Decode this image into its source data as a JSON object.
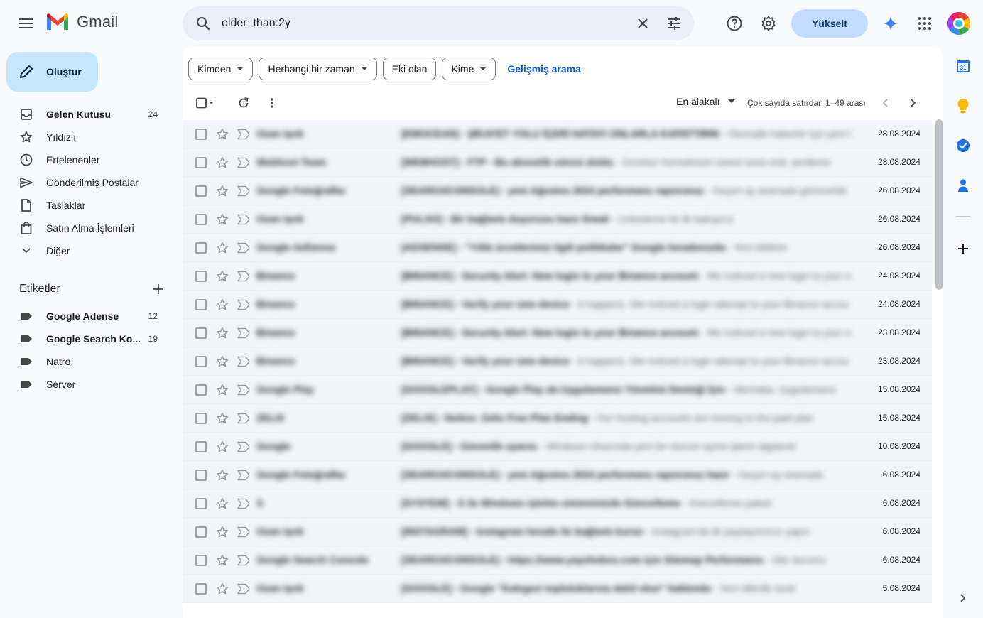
{
  "app": {
    "name": "Gmail"
  },
  "search": {
    "value": "older_than:2y"
  },
  "header": {
    "upgrade_label": "Yükselt"
  },
  "compose": {
    "label": "Oluştur"
  },
  "nav": [
    {
      "label": "Gelen Kutusu",
      "count": "24",
      "icon": "inbox-icon",
      "bold": true
    },
    {
      "label": "Yıldızlı",
      "count": "",
      "icon": "star-icon",
      "bold": false
    },
    {
      "label": "Ertelenenler",
      "count": "",
      "icon": "clock-icon",
      "bold": false
    },
    {
      "label": "Gönderilmiş Postalar",
      "count": "",
      "icon": "send-icon",
      "bold": false
    },
    {
      "label": "Taslaklar",
      "count": "",
      "icon": "draft-icon",
      "bold": false
    },
    {
      "label": "Satın Alma İşlemleri",
      "count": "",
      "icon": "shopping-bag-icon",
      "bold": false
    },
    {
      "label": "Diğer",
      "count": "",
      "icon": "chevron-down-icon",
      "bold": false
    }
  ],
  "labels": {
    "title": "Etiketler",
    "items": [
      {
        "label": "Google Adense",
        "count": "12",
        "bold": true
      },
      {
        "label": "Google Search Ko...",
        "count": "19",
        "bold": true
      },
      {
        "label": "Natro",
        "count": "",
        "bold": false
      },
      {
        "label": "Server",
        "count": "",
        "bold": false
      }
    ]
  },
  "filters": {
    "chips": [
      {
        "label": "Kimden",
        "dropdown": true
      },
      {
        "label": "Herhangi bir zaman",
        "dropdown": true
      },
      {
        "label": "Eki olan",
        "dropdown": false
      },
      {
        "label": "Kime",
        "dropdown": true
      }
    ],
    "advanced_label": "Gelişmiş arama"
  },
  "toolbar": {
    "sort_label": "En alakalı",
    "range_label": "Çok sayıda satırdan 1–49 arası"
  },
  "emails": [
    {
      "sender": "Ozan Işırk",
      "subject": "[EMOCEAN] - ŞİKAYET YOLU İÇERİ HATAYI ONLARLA KAPATTIRIN",
      "snippet": "Otomatik haberler için yeni kayıt",
      "date": "28.08.2024"
    },
    {
      "sender": "Webhost Team",
      "subject": "[WEBHOST] - FTP - Bu abonelik süresi doldu",
      "snippet": "Ücretsiz hizmetinizin süresi sona erdi, yenileme",
      "date": "28.08.2024"
    },
    {
      "sender": "Google Fotoğraflar",
      "subject": "[SEARCHCONSOLE] - yeni Ağustos 2024 performans raporunuz",
      "snippet": "Geçen ay aramada görünürlük",
      "date": "26.08.2024"
    },
    {
      "sender": "Ozan Işırk",
      "subject": "[PULSO] - Bir bağlantı duyurusu hazır Email",
      "snippet": "Linkedeme ile ilk bakışınız",
      "date": "26.08.2024"
    },
    {
      "sender": "Google AdSense",
      "subject": "[ADSENSE] - \"Yıllık ücretlerinizi ilgili politikalar\" Google hesabınızda",
      "snippet": "Yeni bildirim",
      "date": "26.08.2024"
    },
    {
      "sender": "Binance",
      "subject": "[BINANCE] - Security Alert: New login to your Binance account",
      "snippet": "We noticed a new login to your acc",
      "date": "24.08.2024"
    },
    {
      "sender": "Binance",
      "subject": "[BINANCE] - Verify your new device",
      "snippet": "It happens. We noticed a login attempt to your Binance accou",
      "date": "24.08.2024"
    },
    {
      "sender": "Binance",
      "subject": "[BINANCE] - Security Alert: New login to your Binance account",
      "snippet": "We noticed a new login to your acc",
      "date": "23.08.2024"
    },
    {
      "sender": "Binance",
      "subject": "[BINANCE] - Verify your new device",
      "snippet": "It happens. We noticed a login attempt to your Binance accou",
      "date": "23.08.2024"
    },
    {
      "sender": "Google Play",
      "subject": "[GOOGLEPLAY] - Google Play da Uygulamanız Yönetimi Desteği İçin",
      "snippet": "Merhaba, Uygulamanız",
      "date": "15.08.2024"
    },
    {
      "sender": "ZELIX",
      "subject": "[ZELIX] - Notice: Zelix Free Plan Ending",
      "snippet": "Our hosting accounts are moving to the paid plan",
      "date": "15.08.2024"
    },
    {
      "sender": "Google",
      "subject": "[GOOGLE] - Güvenlik uyarısı",
      "snippet": "Windows cihazında yeni bir oturum açma işlemi algılandı",
      "date": "10.08.2024"
    },
    {
      "sender": "Google Fotoğraflar",
      "subject": "[SEARCHCONSOLE] - yeni Ağustos 2024 performans raporunuz hazır",
      "snippet": "Geçen ay aramada",
      "date": "6.08.2024"
    },
    {
      "sender": "S",
      "subject": "[SYSTEM] - S ile Windows işletim sisteminizde Güncelleme",
      "snippet": "Güncelleme paketi",
      "date": "6.08.2024"
    },
    {
      "sender": "Ozan Işırk",
      "subject": "[INSTAGRAM] - Instagram hesabı ile bağlantı kurun",
      "snippet": "Instagram'da ilk paylaşımınızı yapın",
      "date": "6.08.2024"
    },
    {
      "sender": "Google Search Console",
      "subject": "[SEARCHCONSOLE] - https://www.yayzhnbox.com için Sitemap Performansı",
      "snippet": "Site durumu",
      "date": "6.08.2024"
    },
    {
      "sender": "Ozan Işırk",
      "subject": "[GOOGLE] - Google \"Kategori topluluklarına dahil olun\" hakkında",
      "snippet": "Yeni etkinlik özeti",
      "date": "5.08.2024"
    }
  ],
  "colors": {
    "accent": "#0b57d0",
    "compose_bg": "#c2e7ff",
    "upgrade_bg": "#c2dbff",
    "search_bg": "#e9eef6",
    "page_bg": "#f8fafd"
  }
}
